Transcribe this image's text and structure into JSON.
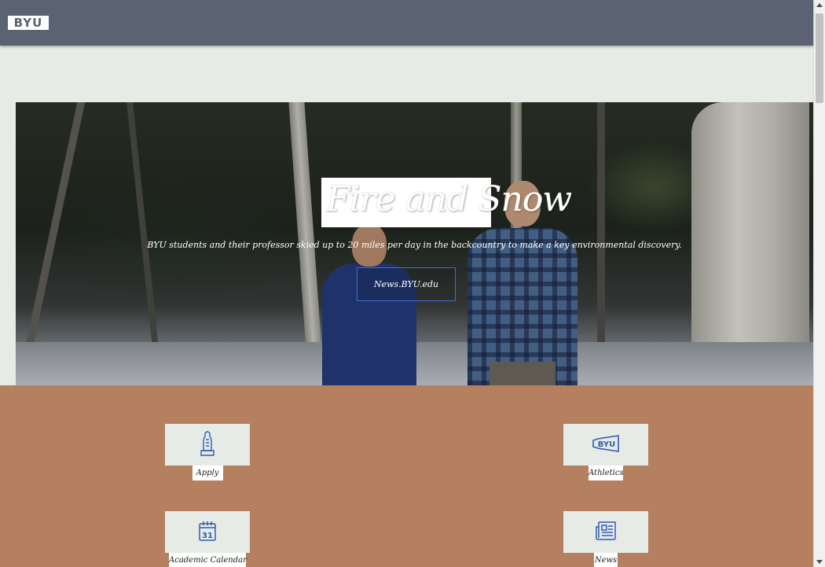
{
  "header": {
    "logo_text": "BYU",
    "background_color": "#5b6373"
  },
  "hero": {
    "title": "Fire and Snow",
    "subtitle": "BYU students and their professor skied up to 20 miles per day in the backcountry to make a key environmental discovery.",
    "button_label": "News.BYU.edu",
    "button_border_color": "#3f6fd1"
  },
  "quick_links": {
    "background_color": "#b5805f",
    "items": [
      {
        "label": "Apply",
        "icon": "cougar-statue-icon"
      },
      {
        "label": "Athletics",
        "icon": "byu-megaphone-icon"
      },
      {
        "label": "Academic Calendar",
        "icon": "calendar-icon",
        "icon_text": "31"
      },
      {
        "label": "News",
        "icon": "newspaper-icon"
      }
    ]
  }
}
